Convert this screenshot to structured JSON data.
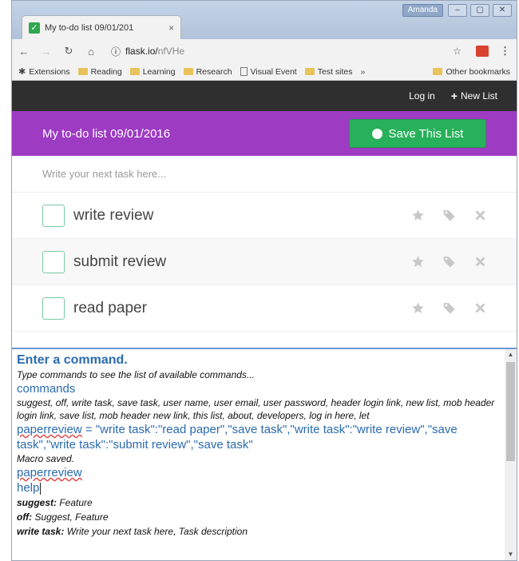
{
  "browser": {
    "tab_title": "My to-do list 09/01/201",
    "tab_close": "×",
    "user_badge": "Amanda",
    "window_buttons": {
      "minimize": "–",
      "maximize": "▢",
      "close": "✕"
    },
    "url_host": "flask.io/",
    "url_path": "nfVHe",
    "bookmarks": [
      {
        "label": "Extensions",
        "icon": "puzzle-icon"
      },
      {
        "label": "Reading",
        "icon": "folder-icon"
      },
      {
        "label": "Learning",
        "icon": "folder-icon"
      },
      {
        "label": "Research",
        "icon": "folder-icon"
      },
      {
        "label": "Visual Event",
        "icon": "page-icon"
      },
      {
        "label": "Test sites",
        "icon": "folder-icon"
      }
    ],
    "bookmarks_more": "»",
    "other_bookmarks": "Other bookmarks"
  },
  "app": {
    "nav": {
      "login": "Log in",
      "new_list": "New List"
    },
    "list_title": "My to-do list 09/01/2016",
    "save_button": "Save This List",
    "task_placeholder": "Write your next task here...",
    "tasks": [
      {
        "text": "write review"
      },
      {
        "text": "submit review"
      },
      {
        "text": "read paper"
      }
    ]
  },
  "console": {
    "title": "Enter a command.",
    "hint": "Type commands to see the list of available commands...",
    "cmd1": "commands",
    "commands_list": "suggest, off, write task, save task, user name, user email, user password, header login link, new list, mob header login link, save list, mob header new link, this list, about, developers, log in here, let",
    "macro_name": "paperreview",
    "macro_def": " = \"write task\":\"read paper\",\"save task\",\"write task\":\"write review\",\"save task\",\"write task\":\"submit review\",\"save task\"",
    "macro_saved": "Macro saved.",
    "cmd2": "paperreview",
    "cmd3": "help",
    "help_lines": [
      {
        "key": "suggest:",
        "desc": " Feature"
      },
      {
        "key": "off:",
        "desc": " Suggest, Feature"
      },
      {
        "key": "write task:",
        "desc": " Write your next task here, Task description"
      }
    ]
  },
  "colors": {
    "header_purple": "#9d3bc3",
    "save_green": "#27b15a",
    "nav_dark": "#2f2f2f",
    "console_blue": "#2a6bb0"
  }
}
